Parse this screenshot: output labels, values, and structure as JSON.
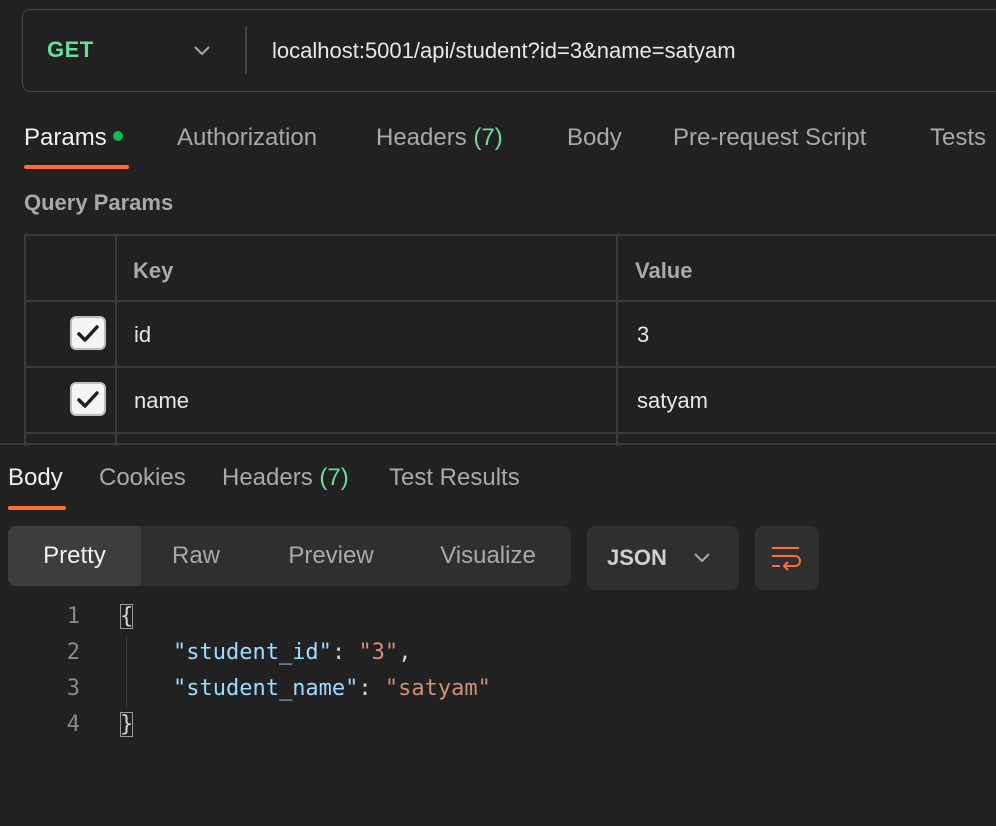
{
  "request": {
    "method": "GET",
    "url": "localhost:5001/api/student?id=3&name=satyam"
  },
  "request_tabs": {
    "params": "Params",
    "authorization": "Authorization",
    "headers": "Headers",
    "headers_count": "(7)",
    "body": "Body",
    "prerequest": "Pre-request Script",
    "tests": "Tests"
  },
  "query_params": {
    "title": "Query Params",
    "headers": {
      "key": "Key",
      "value": "Value"
    },
    "rows": [
      {
        "checked": true,
        "key": "id",
        "value": "3"
      },
      {
        "checked": true,
        "key": "name",
        "value": "satyam"
      }
    ]
  },
  "response_tabs": {
    "body": "Body",
    "cookies": "Cookies",
    "headers": "Headers",
    "headers_count": "(7)",
    "test_results": "Test Results"
  },
  "view_modes": {
    "pretty": "Pretty",
    "raw": "Raw",
    "preview": "Preview",
    "visualize": "Visualize",
    "format": "JSON"
  },
  "code": {
    "line_numbers": [
      "1",
      "2",
      "3",
      "4"
    ],
    "open_brace": "{",
    "close_brace": "}",
    "key1": "\"student_id\"",
    "val1": "\"3\"",
    "key2": "\"student_name\"",
    "val2": "\"satyam\""
  },
  "colors": {
    "accent": "#ff6c37",
    "method_green": "#6bdd9a",
    "background": "#212121"
  }
}
